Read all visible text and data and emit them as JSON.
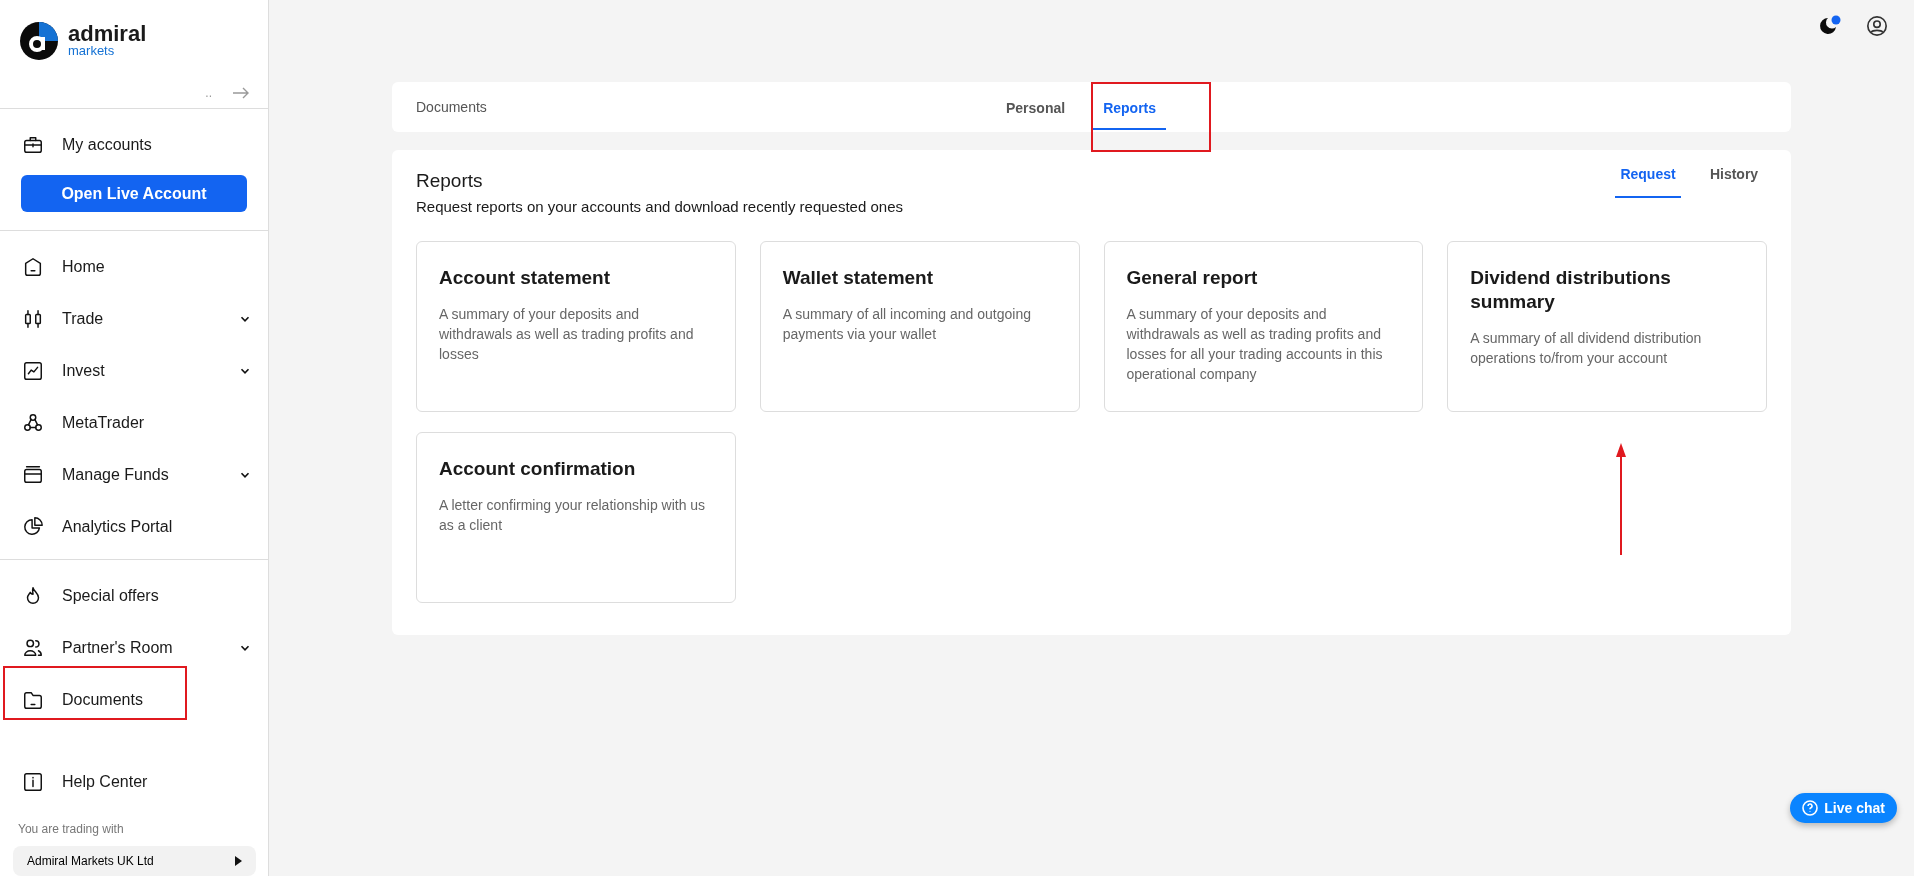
{
  "logo": {
    "name": "admiral",
    "sub": "markets"
  },
  "sidebar": {
    "collapse_label": "..",
    "account_item": "My accounts",
    "open_button": "Open Live Account",
    "menu": [
      {
        "label": "Home",
        "expandable": false
      },
      {
        "label": "Trade",
        "expandable": true
      },
      {
        "label": "Invest",
        "expandable": true
      },
      {
        "label": "MetaTrader",
        "expandable": false
      },
      {
        "label": "Manage Funds",
        "expandable": true
      },
      {
        "label": "Analytics Portal",
        "expandable": false
      }
    ],
    "extra": [
      {
        "label": "Special offers",
        "expandable": false
      },
      {
        "label": "Partner's Room",
        "expandable": true
      },
      {
        "label": "Documents",
        "expandable": false
      }
    ],
    "help": "Help Center",
    "trading_with": "You are trading with",
    "company": "Admiral Markets UK Ltd"
  },
  "top_bar": {
    "title": "Documents",
    "tabs": [
      {
        "label": "Personal",
        "selected": false
      },
      {
        "label": "Reports",
        "selected": true
      }
    ]
  },
  "panel": {
    "title": "Reports",
    "subtitle": "Request reports on your accounts and download recently requested ones",
    "tabs": [
      {
        "label": "Request",
        "selected": true
      },
      {
        "label": "History",
        "selected": false
      }
    ],
    "cards": [
      {
        "title": "Account statement",
        "text": "A summary of your deposits and withdrawals as well as trading profits and losses"
      },
      {
        "title": "Wallet statement",
        "text": "A summary of all incoming and outgoing payments via your wallet"
      },
      {
        "title": "General report",
        "text": "A summary of your deposits and withdrawals as well as trading profits and losses for all your trading accounts in this operational company"
      },
      {
        "title": "Dividend distributions summary",
        "text": "A summary of all dividend distribution operations to/from your account"
      },
      {
        "title": "Account confirmation",
        "text": "A letter confirming your relationship with us as a client"
      }
    ]
  },
  "live_chat": "Live chat"
}
